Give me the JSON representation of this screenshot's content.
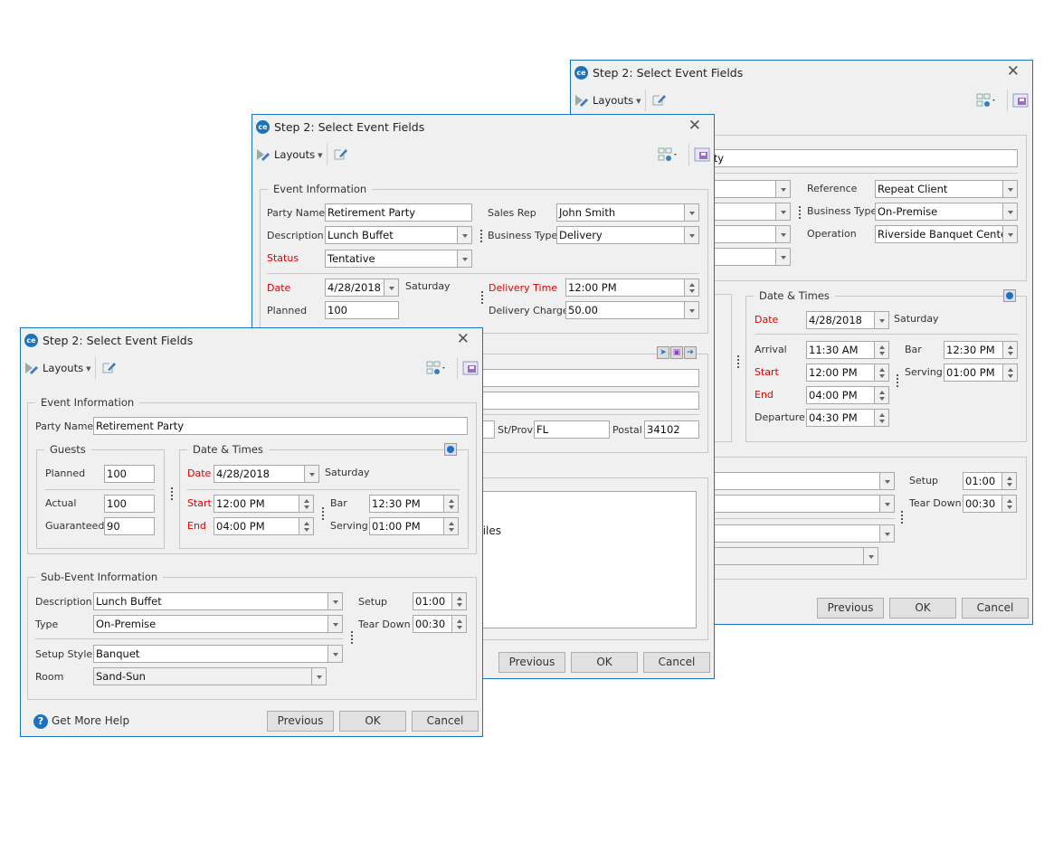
{
  "colors": {
    "accent": "#1a73c0",
    "required": "#e00000"
  },
  "common": {
    "title": "Step 2:  Select Event Fields",
    "logo": "ce",
    "layouts_label": "Layouts",
    "buttons": {
      "previous": "Previous",
      "ok": "OK",
      "cancel": "Cancel"
    },
    "icons": {
      "close": "close-icon",
      "layouts": "layouts-icon",
      "edit": "edit-icon",
      "grid_options": "grid-options-icon",
      "save_layout": "save-layout-icon",
      "clock": "clock-icon"
    }
  },
  "back_dialog": {
    "party_name_partial": "rty",
    "reference": {
      "label": "Reference",
      "value": "Repeat Client"
    },
    "business_type": {
      "label": "Business Type",
      "value": "On-Premise"
    },
    "operation": {
      "label": "Operation",
      "value": "Riverside Banquet Center"
    },
    "date_times": {
      "title": "Date & Times",
      "date": {
        "label": "Date",
        "value": "4/28/2018",
        "day": "Saturday"
      },
      "arrival": {
        "label": "Arrival",
        "value": "11:30 AM"
      },
      "start": {
        "label": "Start",
        "value": "12:00 PM"
      },
      "end": {
        "label": "End",
        "value": "04:00 PM"
      },
      "departure": {
        "label": "Departure",
        "value": "04:30 PM"
      },
      "bar": {
        "label": "Bar",
        "value": "12:30 PM"
      },
      "serving": {
        "label": "Serving",
        "value": "01:00 PM"
      }
    },
    "setup": {
      "label": "Setup",
      "value": "01:00"
    },
    "tear_down": {
      "label": "Tear Down",
      "value": "00:30"
    }
  },
  "middle_dialog": {
    "event_info_title": "Event Information",
    "party_name": {
      "label": "Party Name",
      "value": "Retirement Party"
    },
    "description": {
      "label": "Description",
      "value": "Lunch Buffet"
    },
    "status": {
      "label": "Status",
      "value": "Tentative"
    },
    "sales_rep": {
      "label": "Sales Rep",
      "value": "John Smith"
    },
    "business_type": {
      "label": "Business Type",
      "value": "Delivery"
    },
    "date": {
      "label": "Date",
      "value": "4/28/2018",
      "day": "Saturday"
    },
    "planned": {
      "label": "Planned",
      "value": "100"
    },
    "delivery_time": {
      "label": "Delivery Time",
      "value": "12:00 PM"
    },
    "delivery_charge": {
      "label": "Delivery Charge",
      "value": "50.00"
    },
    "st_prov": {
      "label": "St/Prov",
      "value": "FL"
    },
    "postal": {
      "label": "Postal",
      "value": "34102"
    },
    "notes_partial": "miles"
  },
  "front_dialog": {
    "event_info_title": "Event Information",
    "party_name": {
      "label": "Party Name",
      "value": "Retirement Party"
    },
    "guests": {
      "title": "Guests",
      "planned": {
        "label": "Planned",
        "value": "100"
      },
      "actual": {
        "label": "Actual",
        "value": "100"
      },
      "guaranteed": {
        "label": "Guaranteed",
        "value": "90"
      }
    },
    "date_times": {
      "title": "Date & Times",
      "date": {
        "label": "Date",
        "value": "4/28/2018",
        "day": "Saturday"
      },
      "start": {
        "label": "Start",
        "value": "12:00 PM"
      },
      "end": {
        "label": "End",
        "value": "04:00 PM"
      },
      "bar": {
        "label": "Bar",
        "value": "12:30 PM"
      },
      "serving": {
        "label": "Serving",
        "value": "01:00 PM"
      }
    },
    "sub_event": {
      "title": "Sub-Event Information",
      "description": {
        "label": "Description",
        "value": "Lunch Buffet"
      },
      "type": {
        "label": "Type",
        "value": "On-Premise"
      },
      "setup_style": {
        "label": "Setup Style",
        "value": "Banquet"
      },
      "room": {
        "label": "Room",
        "value": "Sand-Sun"
      },
      "setup": {
        "label": "Setup",
        "value": "01:00"
      },
      "tear_down": {
        "label": "Tear Down",
        "value": "00:30"
      }
    },
    "help_label": "Get More Help"
  }
}
